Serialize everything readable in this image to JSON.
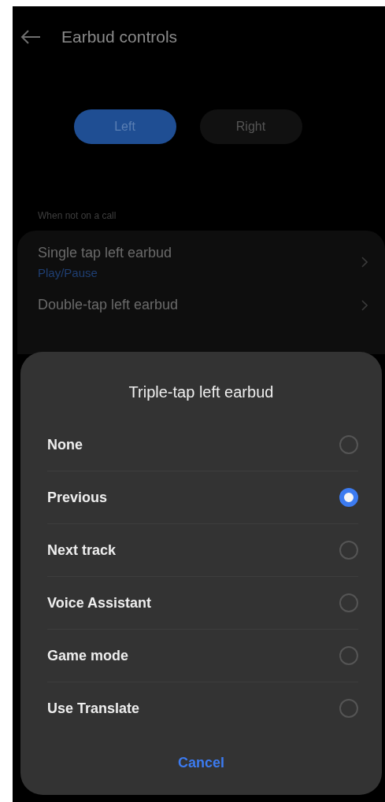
{
  "header": {
    "title": "Earbud controls"
  },
  "sides": [
    {
      "label": "Left",
      "selected": true
    },
    {
      "label": "Right",
      "selected": false
    }
  ],
  "section": "When not on a call",
  "settings": [
    {
      "title": "Single tap left earbud",
      "value": "Play/Pause"
    },
    {
      "title": "Double-tap left earbud"
    }
  ],
  "dialog": {
    "title": "Triple-tap left earbud",
    "options": [
      {
        "label": "None",
        "selected": false
      },
      {
        "label": "Previous",
        "selected": true
      },
      {
        "label": "Next track",
        "selected": false
      },
      {
        "label": "Voice Assistant",
        "selected": false
      },
      {
        "label": "Game mode",
        "selected": false
      },
      {
        "label": "Use Translate",
        "selected": false
      }
    ],
    "cancel": "Cancel"
  }
}
